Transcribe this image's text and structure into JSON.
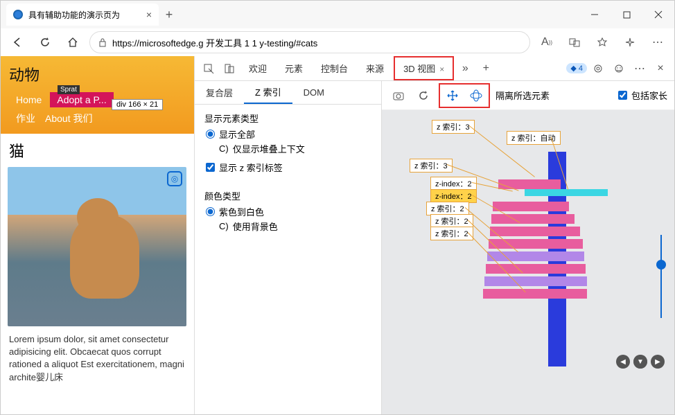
{
  "window": {
    "title": "具有辅助功能的演示页为"
  },
  "address": {
    "url": "https://microsoftedge.g 开发工具 1 1 y-testing/#cats"
  },
  "page": {
    "h1": "动物",
    "nav1": {
      "home": "Home",
      "adopt": "Adopt a P..."
    },
    "nav2": {
      "work": "作业",
      "about": "About 我们"
    },
    "tooltip_label": "Sprat",
    "tooltip_dim": "div     166 × 21",
    "h2": "猫",
    "lorem": "Lorem ipsum dolor, sit amet consectetur adipisicing elit. Obcaecat quos corrupt rationed a aliquot Est exercitationem, magni archite婴儿床"
  },
  "devtools": {
    "tabs": {
      "welcome": "欢迎",
      "elements": "元素",
      "console": "控制台",
      "sources": "来源",
      "view3d": "3D 视图"
    },
    "issue_count": "4",
    "subtabs": {
      "layers": "复合层",
      "zindex": "Z 索引",
      "dom": "DOM"
    },
    "section1": {
      "title": "显示元素类型",
      "opt1": "显示全部",
      "opt2": "仅显示堆叠上下文",
      "chk": "显示 z 索引标签"
    },
    "section2": {
      "title": "颜色类型",
      "opt1": "紫色到白色",
      "opt2": "使用背景色"
    },
    "toolbar": {
      "isolate": "隔离所选元素",
      "parents": "包括家长"
    },
    "labels": {
      "z3a": "z 索引：3",
      "zauto": "z 索引：自动",
      "z3b": "z 索引：3",
      "zi2a": "z-index：2",
      "zi2b": "z-index：2",
      "z2a": "z 索引：2",
      "z2b": "z 索引：2",
      "z2c": "z 索引：2"
    }
  }
}
